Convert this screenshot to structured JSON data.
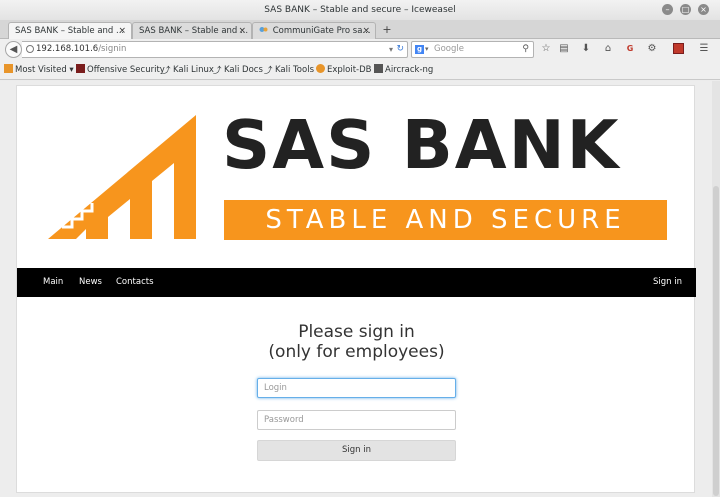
{
  "window": {
    "title": "SAS BANK – Stable and secure – Iceweasel"
  },
  "tabs": [
    {
      "label": "SAS BANK – Stable and ...",
      "close": "×"
    },
    {
      "label": "SAS BANK – Stable and ...",
      "close": "×"
    },
    {
      "label": "CommuniGate Pro sa...",
      "close": "×"
    }
  ],
  "new_tab_label": "+",
  "address": {
    "host": "192.168.101.6",
    "path": "/signin"
  },
  "search": {
    "placeholder": "Google",
    "engine_letter": "g"
  },
  "bookmarks": [
    {
      "label": "Most Visited ▾",
      "icon": "folder-icon",
      "color": "#e8952a"
    },
    {
      "label": "Offensive Security",
      "icon": "offsec-icon",
      "color": "#7a1d1d"
    },
    {
      "label": "Kali Linux",
      "icon": "kali-icon",
      "color": "#222222"
    },
    {
      "label": "Kali Docs",
      "icon": "kali-icon",
      "color": "#222222"
    },
    {
      "label": "Kali Tools",
      "icon": "kali-icon",
      "color": "#222222"
    },
    {
      "label": "Exploit-DB",
      "icon": "exploitdb-icon",
      "color": "#e8952a"
    },
    {
      "label": "Aircrack-ng",
      "icon": "aircrack-icon",
      "color": "#444444"
    }
  ],
  "site": {
    "brand": "SAS BANK",
    "tagline": "STABLE AND SECURE",
    "brand_color": "#f7951d",
    "nav": [
      {
        "label": "Main"
      },
      {
        "label": "News"
      },
      {
        "label": "Contacts"
      }
    ],
    "nav_right": "Sign in"
  },
  "form": {
    "heading_line1": "Please sign in",
    "heading_line2": "(only for employees)",
    "login_placeholder": "Login",
    "login_value": "",
    "password_placeholder": "Password",
    "submit_label": "Sign in"
  }
}
